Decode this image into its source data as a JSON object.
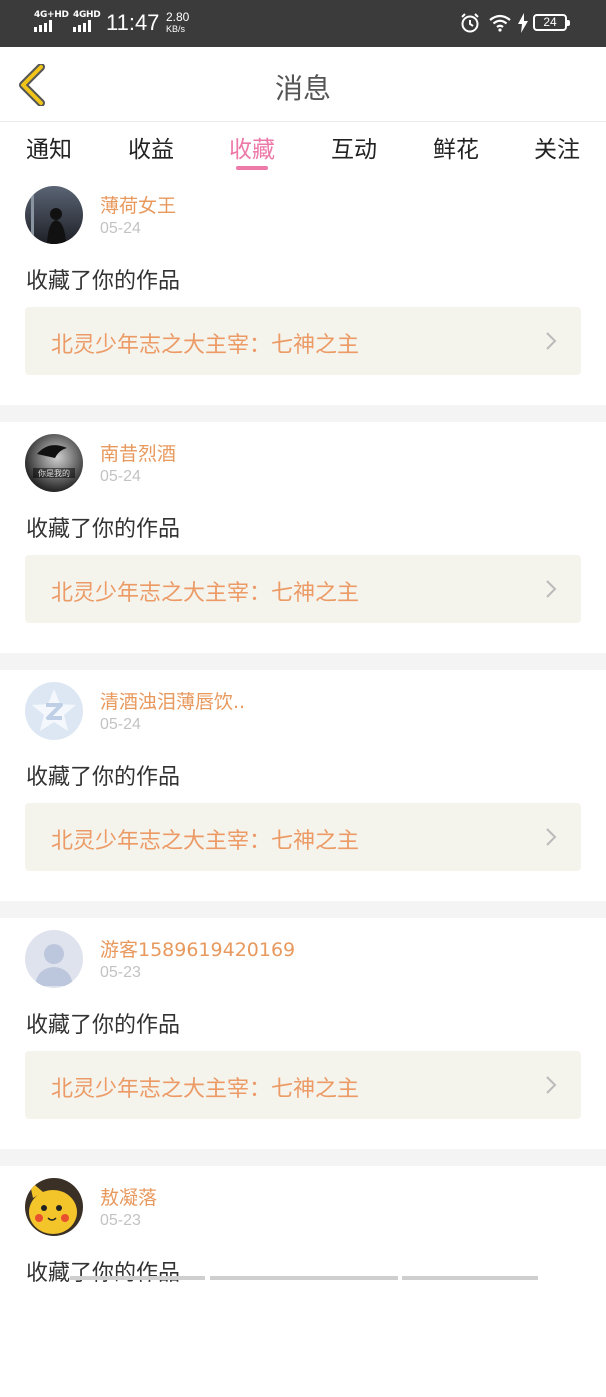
{
  "status_bar": {
    "network_1": "4G+HD",
    "network_2": "4GHD",
    "time": "11:47",
    "speed_value": "2.80",
    "speed_unit": "KB/s",
    "battery": "24",
    "icons": [
      "alarm-icon",
      "wifi-icon",
      "charging-icon",
      "battery-icon"
    ]
  },
  "header": {
    "title": "消息",
    "back_icon": "chevron-left-icon",
    "accent": "#f0c419"
  },
  "tabs": [
    {
      "label": "通知",
      "active": false
    },
    {
      "label": "收益",
      "active": false
    },
    {
      "label": "收藏",
      "active": true
    },
    {
      "label": "互动",
      "active": false
    },
    {
      "label": "鲜花",
      "active": false
    },
    {
      "label": "关注",
      "active": false
    }
  ],
  "colors": {
    "active_tab": "#ec79a8",
    "username": "#e8995e",
    "work_title": "#ec9a66",
    "card_bg": "#f4f4ec"
  },
  "messages": [
    {
      "username": "薄荷女王",
      "date": "05-24",
      "text": "收藏了你的作品",
      "work": "北灵少年志之大主宰：七神之主",
      "avatar": "dark-photo-avatar"
    },
    {
      "username": "南昔烈酒",
      "date": "05-24",
      "text": "收藏了你的作品",
      "work": "北灵少年志之大主宰：七神之主",
      "avatar_caption": "你是我的",
      "avatar": "bw-photo-avatar"
    },
    {
      "username": "清酒浊泪薄唇饮..",
      "date": "05-24",
      "text": "收藏了你的作品",
      "work": "北灵少年志之大主宰：七神之主",
      "avatar": "z-logo-avatar"
    },
    {
      "username": "游客1589619420169",
      "date": "05-23",
      "text": "收藏了你的作品",
      "work": "北灵少年志之大主宰：七神之主",
      "avatar": "default-user-avatar"
    },
    {
      "username": "敖凝落",
      "date": "05-23",
      "text": "收藏了你的作品",
      "work": "",
      "avatar": "pikachu-avatar"
    }
  ]
}
